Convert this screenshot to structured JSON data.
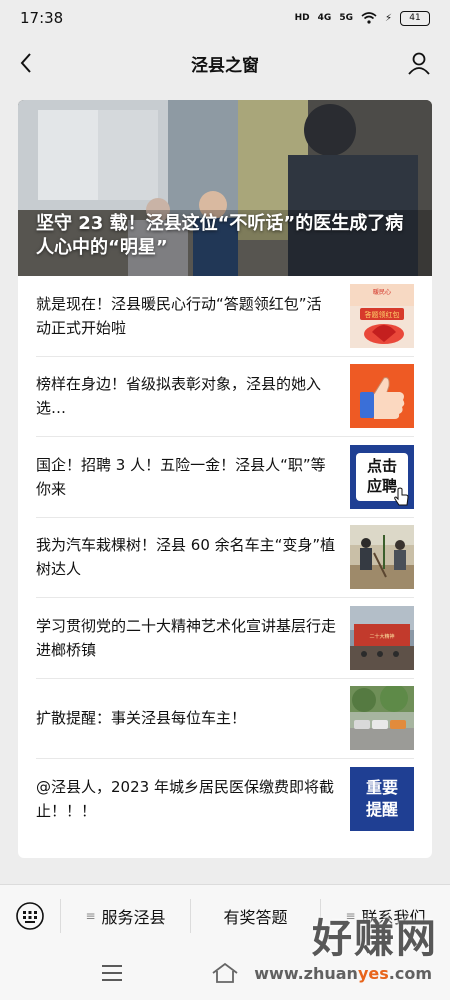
{
  "status": {
    "time": "17:38",
    "hd": "HD",
    "net1": "4G",
    "net2": "5G",
    "battery": "41"
  },
  "header": {
    "title": "泾县之窗"
  },
  "hero": {
    "title": "坚守 23 载！泾县这位“不听话”的医生成了病人心中的“明星”"
  },
  "articles": [
    {
      "title": "就是现在！泾县暖民心行动“答题领红包”活动正式开始啦",
      "thumb": "red-envelope-banner",
      "thumb_text": "暖民心 答题领红包"
    },
    {
      "title": "榜样在身边！省级拟表彰对象，泾县的她入选…",
      "thumb": "thumbs-up-icon"
    },
    {
      "title": "国企！招聘 3 人！五险一金！泾县人“职”等你来",
      "thumb": "click-apply-badge",
      "thumb_text": [
        "点击",
        "应聘"
      ]
    },
    {
      "title": "我为汽车栽棵树！泾县 60 余名车主“变身”植树达人",
      "thumb": "tree-planting-photo"
    },
    {
      "title": "学习贯彻党的二十大精神艺术化宣讲基层行走进榔桥镇",
      "thumb": "stage-performance-photo"
    },
    {
      "title": "扩散提醒：事关泾县每位车主！",
      "thumb": "parking-lot-photo"
    },
    {
      "title": "@泾县人，2023 年城乡居民医保缴费即将截止！！！",
      "thumb": "important-reminder-badge",
      "thumb_text": [
        "重要",
        "提醒"
      ]
    }
  ],
  "menu": [
    {
      "label": "服务泾县",
      "has_submenu": true
    },
    {
      "label": "有奖答题",
      "has_submenu": false
    },
    {
      "label": "联系我们",
      "has_submenu": true
    }
  ],
  "watermark": {
    "big": "好赚网",
    "small_pre": "www.zhuan",
    "small_hl": "yes",
    "small_post": ".com"
  },
  "colors": {
    "background": "#ededed",
    "card": "#ffffff",
    "accent_blue": "#1f3f93",
    "accent_orange": "#e8641b"
  }
}
